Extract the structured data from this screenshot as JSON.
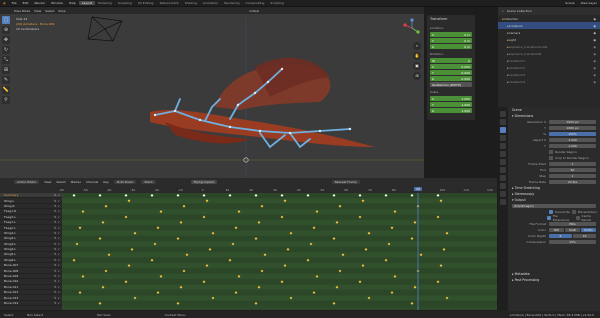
{
  "menu": {
    "items": [
      "File",
      "Edit",
      "Render",
      "Window",
      "Help"
    ],
    "workspaces": [
      "Layout",
      "Modeling",
      "Sculpting",
      "UV Editing",
      "Texture Paint",
      "Shading",
      "Animation",
      "Rendering",
      "Compositing",
      "Scripting"
    ],
    "active_workspace": "Layout",
    "scene_label": "Scene",
    "view_layer_label": "View Layer"
  },
  "viewport": {
    "mode": "Pose Mode",
    "menus": [
      "View",
      "Select",
      "Pose"
    ],
    "orientation": "Global",
    "info_line1": "Side 24",
    "info_line2": "(29) Armature : Bone.009",
    "info_line3": "10 Centimeters",
    "n_panel": {
      "title": "Transform",
      "location_label": "Location:",
      "location": [
        "0 m",
        "0 m",
        "0 m"
      ],
      "rotation_label": "Rotation:",
      "rotation": [
        "0",
        "0.000",
        "0.000",
        "0.000"
      ],
      "mode_label": "Quaternion (WXYZ)",
      "scale_label": "Scale:",
      "scale": [
        "1.000",
        "1.000",
        "1.000"
      ]
    }
  },
  "timeline": {
    "editor": "Action Editor",
    "menus": [
      "View",
      "Select",
      "Marker",
      "Channel",
      "Key"
    ],
    "push_down": "Push Down",
    "stash": "Stash",
    "action_name": "Flying.copied",
    "interp": "Nearest Frame",
    "current_frame": "29",
    "ruler": [
      "-60",
      "-50",
      "-40",
      "-30",
      "-20",
      "-10",
      "0",
      "10",
      "20",
      "30",
      "40",
      "50",
      "60",
      "70",
      "80",
      "90",
      "100",
      "110",
      "120"
    ],
    "channels": [
      "Summary",
      "Wing.L",
      "Wing.R",
      "FLeg1.R",
      "FLeg2.L",
      "FLeg1.L",
      "FLeg2.L",
      "Wing1.L",
      "Wing2.L",
      "Wing3.L",
      "Wing4.L",
      "Wing5.L",
      "Wing6.L",
      "Bone.007",
      "Bone.008",
      "Bone.009",
      "Bone.010",
      "Bone.011",
      "Bone.012",
      "Bone.013",
      "Bone.014"
    ]
  },
  "outliner": {
    "title": "Scene Collection",
    "items": [
      {
        "name": "Collection",
        "sel": false
      },
      {
        "name": "Armature",
        "sel": true
      },
      {
        "name": "Camera",
        "sel": false
      },
      {
        "name": "Light",
        "sel": false
      },
      {
        "name": "explosion_transformA.001",
        "sel": false
      },
      {
        "name": "explosion_transformB",
        "sel": false
      },
      {
        "name": "transform1",
        "sel": false
      },
      {
        "name": "transform2",
        "sel": false
      },
      {
        "name": "transform3",
        "sel": false
      },
      {
        "name": "transform4",
        "sel": false
      }
    ]
  },
  "properties": {
    "scene_name": "Scene",
    "dimensions_title": "Dimensions",
    "resolution_x": "1920 px",
    "resolution_y": "1080 px",
    "resolution_pct": "100%",
    "aspect_x": "1.000",
    "aspect_y": "1.000",
    "render_region": "Render Region",
    "crop": "Crop to Render Region",
    "frame_start": "1",
    "frame_end": "60",
    "frame_step": "1",
    "frame_rate": "24 fps",
    "time_stretching": "Time Stretching",
    "stereoscopy": "Stereoscopy",
    "output_title": "Output",
    "output_path": "/tmp/Dragon\\",
    "overwrite": "Overwrite",
    "placeholders": "Placeholders",
    "file_ext": "File Extensions",
    "cache_result": "Cache Result",
    "file_format": "PNG",
    "color_modes": [
      "BW",
      "RGB",
      "RGBA"
    ],
    "color_depth": [
      "8",
      "16"
    ],
    "compression": "15%",
    "metadata": "Metadata",
    "post_processing": "Post Processing"
  },
  "status": {
    "select": "Select",
    "box_select": "Box Select",
    "move": "Pan View",
    "context": "Context Menu",
    "right": "Armature | Bone.009 | Verts 0 | Mem: 48.4 MiB | v2.92.0"
  },
  "colors": {
    "accent": "#5680c2",
    "key_area": "#2f4a2a",
    "keyframe": "#f0c040",
    "bone": "#6fb0e0",
    "dragon_body": "#a9462a",
    "field_green": "#4b8f36"
  }
}
